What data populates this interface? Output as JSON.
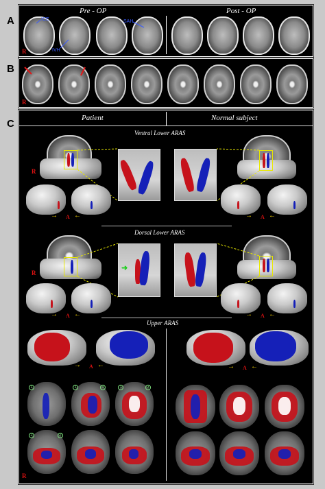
{
  "panels": {
    "a_label": "A",
    "b_label": "B",
    "c_label": "C"
  },
  "panel_a": {
    "pre_op": "Pre - OP",
    "post_op": "Post - OP",
    "ice": "ICE",
    "ivh": "IVH",
    "sah": "SAH",
    "orientation": "R"
  },
  "panel_b": {
    "orientation": "R"
  },
  "panel_c": {
    "patient": "Patient",
    "normal_subject": "Normal subject",
    "ventral": "Ventral Lower ARAS",
    "dorsal": "Dorsal Lower ARAS",
    "upper": "Upper ARAS",
    "orientation": "R",
    "anterior": "A",
    "marker_1": "1",
    "marker_2": "2",
    "marker_3": "3"
  },
  "colors": {
    "tract_red": "#c6121b",
    "tract_blue": "#1520b8",
    "highlight": "#e8e800",
    "annotation_blue": "#3a5bff"
  }
}
